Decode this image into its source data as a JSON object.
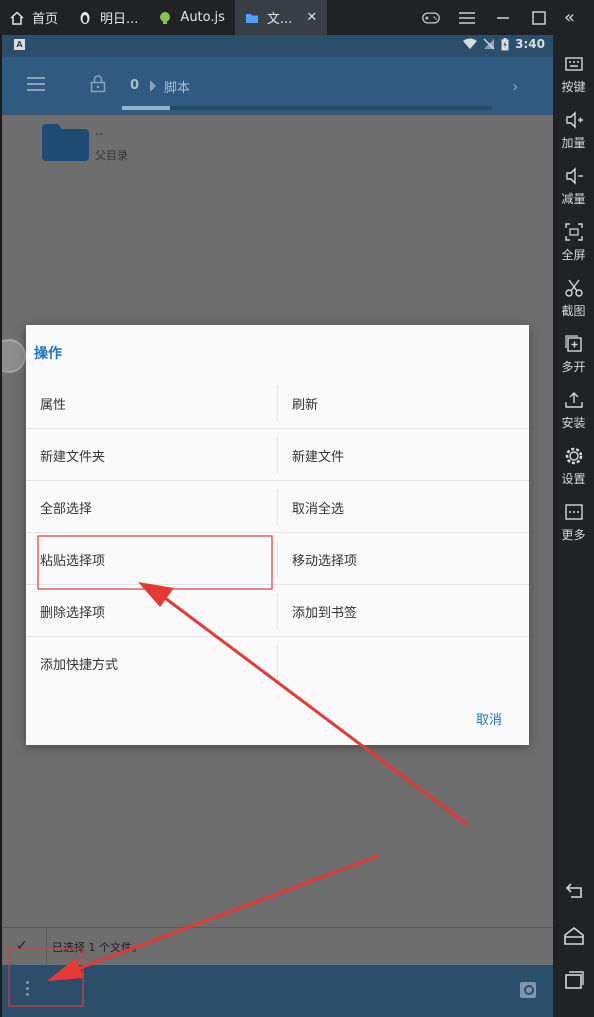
{
  "emulator": {
    "tabs": [
      {
        "label": "首页",
        "icon": "home-icon"
      },
      {
        "label": "明日...",
        "icon": "penguin-icon"
      },
      {
        "label": "Auto.js",
        "icon": "android-icon"
      },
      {
        "label": "文...",
        "icon": "folder-icon"
      }
    ],
    "sidebar": [
      {
        "label": "按键",
        "icon": "keyboard-icon"
      },
      {
        "label": "加量",
        "icon": "volume-up-icon"
      },
      {
        "label": "减量",
        "icon": "volume-down-icon"
      },
      {
        "label": "全屏",
        "icon": "fullscreen-icon"
      },
      {
        "label": "截图",
        "icon": "scissors-icon"
      },
      {
        "label": "多开",
        "icon": "multi-open-icon"
      },
      {
        "label": "安装",
        "icon": "install-icon"
      },
      {
        "label": "设置",
        "icon": "gear-icon"
      },
      {
        "label": "更多",
        "icon": "more-icon"
      }
    ]
  },
  "status": {
    "time": "3:40"
  },
  "appbar": {
    "crumb_root": "0",
    "crumb_current": "脚本",
    "progress": 0.13
  },
  "files": [
    {
      "name": "..",
      "subtitle": "父目录"
    }
  ],
  "dialog": {
    "title": "操作",
    "rows": [
      [
        "属性",
        "刷新"
      ],
      [
        "新建文件夹",
        "新建文件"
      ],
      [
        "全部选择",
        "取消全选"
      ],
      [
        "粘贴选择项",
        "移动选择项"
      ],
      [
        "删除选择项",
        "添加到书签"
      ],
      [
        "添加快捷方式",
        ""
      ]
    ],
    "cancel": "取消"
  },
  "selection": {
    "text": "已选择 1 个文件。"
  },
  "colors": {
    "accent": "#1f74c4",
    "annotation": "#e53935"
  }
}
